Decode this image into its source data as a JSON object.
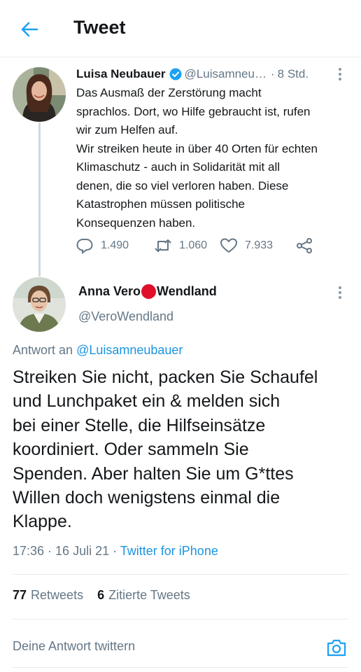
{
  "header": {
    "title": "Tweet"
  },
  "colors": {
    "accent": "#1da1f2",
    "link": "#1b95e0",
    "muted": "#657786",
    "red_dot": "#e0102a"
  },
  "original_tweet": {
    "author_name": "Luisa Neubauer",
    "handle": "@Luisamneu…",
    "separator": "·",
    "time": "8 Std.",
    "text_lines": [
      "Das Ausmaß der Zerstörung macht",
      "sprachlos. Dort, wo Hilfe gebraucht ist, rufen",
      "wir zum Helfen auf.",
      "Wir streiken heute in über 40 Orten für echten",
      "Klimaschutz - auch in Solidarität mit all",
      "denen, die so viel verloren haben. Diese",
      "Katastrophen müssen politische",
      "Konsequenzen haben."
    ],
    "replies": "1.490",
    "retweets": "1.060",
    "likes": "7.933",
    "icons": [
      "verified-icon",
      "reply-icon",
      "retweet-icon",
      "like-icon",
      "share-icon",
      "more-icon"
    ]
  },
  "reply_tweet": {
    "name_part1": "Anna Vero",
    "name_part2": "Wendland",
    "handle": "@VeroWendland",
    "reply_prefix": "Antwort an",
    "reply_to": "@Luisamneubauer",
    "text_lines": [
      "Streiken Sie nicht, packen Sie Schaufel",
      "und Lunchpaket ein & melden sich",
      "bei einer Stelle, die Hilfseinsätze",
      "koordiniert. Oder sammeln Sie",
      "Spenden. Aber halten Sie um G*ttes",
      "Willen doch wenigstens einmal die",
      "Klappe."
    ],
    "timestamp": "17:36 · 16 Juli 21 ·",
    "source": "Twitter for iPhone",
    "retweets_count": "77",
    "retweets_label": "Retweets",
    "quotes_count": "6",
    "quotes_label": "Zitierte Tweets"
  },
  "compose": {
    "placeholder": "Deine Antwort twittern",
    "icon": "camera-icon"
  }
}
